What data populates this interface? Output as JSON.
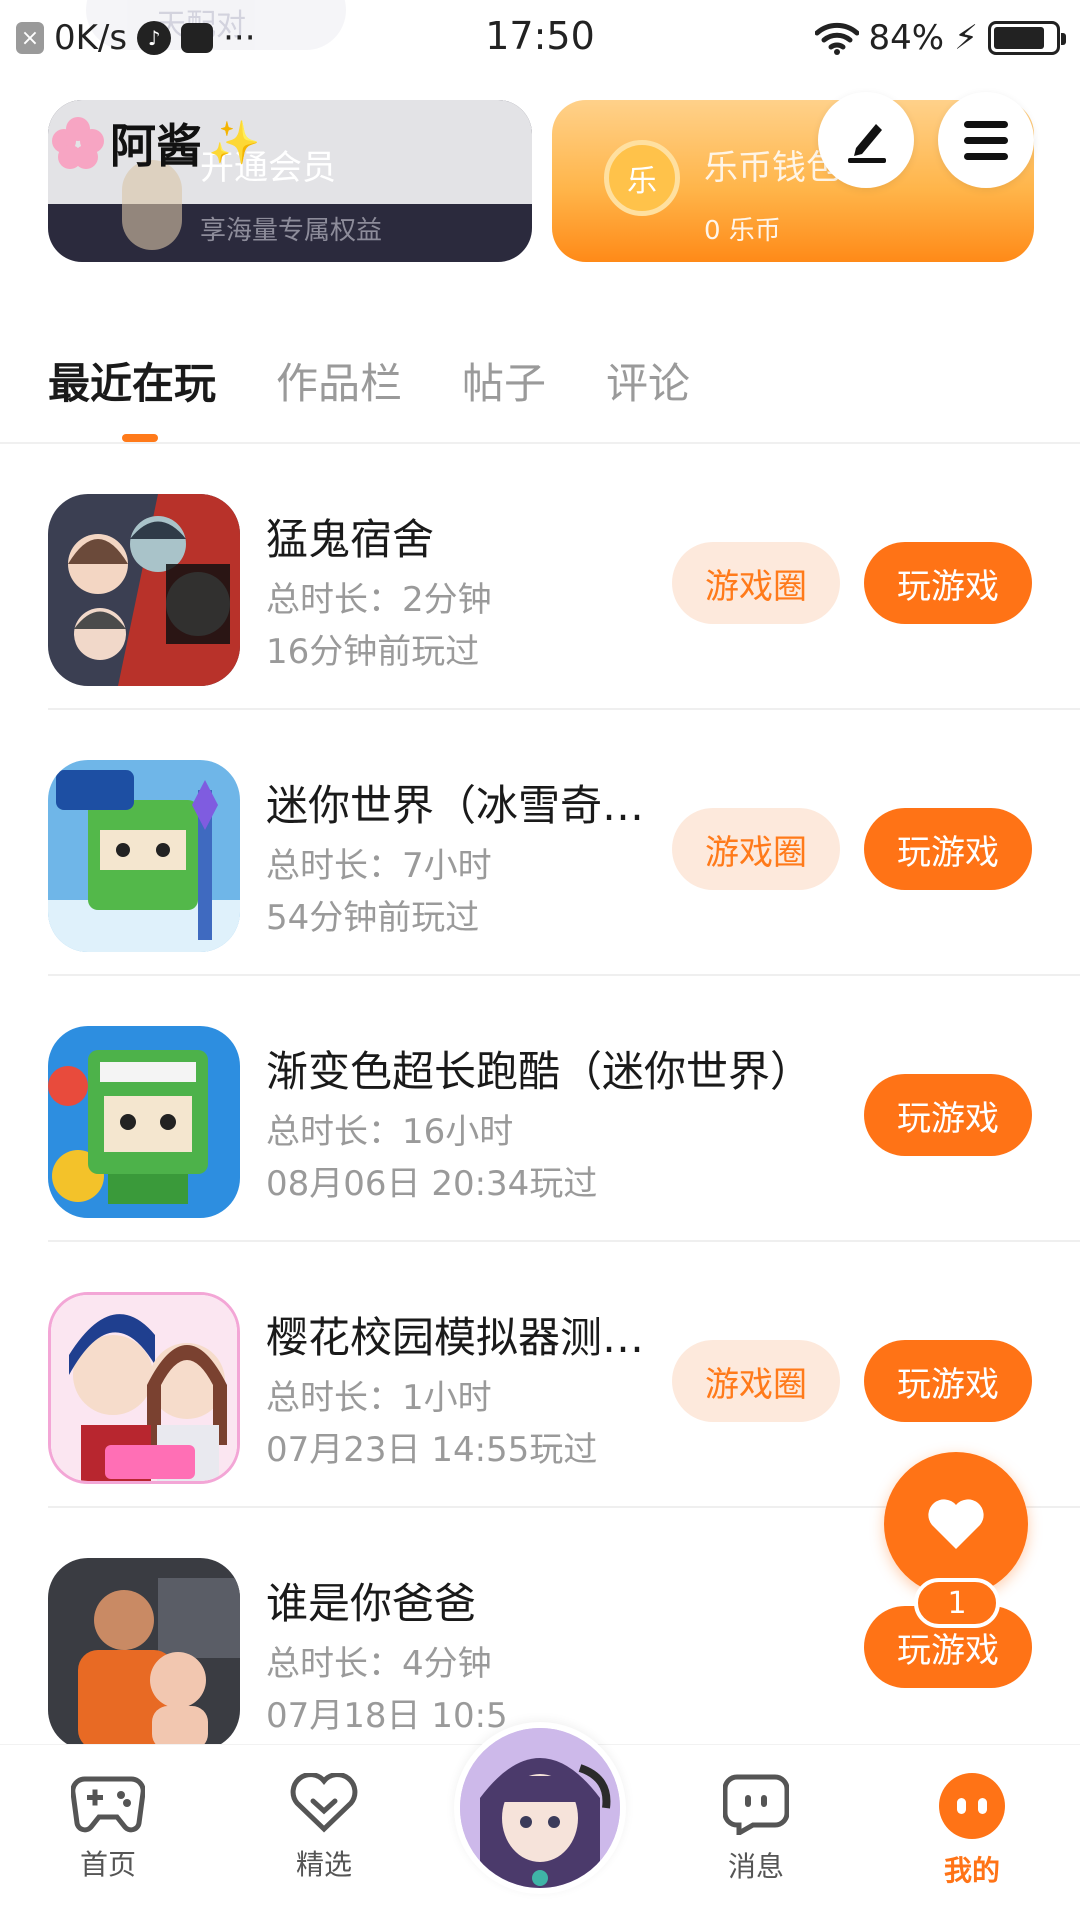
{
  "status_bar": {
    "net_speed": "0K/s",
    "time": "17:50",
    "battery": "84%",
    "battery_level": 0.84
  },
  "faded_banner": "天配对",
  "header": {
    "username": "阿酱",
    "vip_card": {
      "title": "开通会员",
      "subtitle": "享海量专属权益"
    },
    "wallet_card": {
      "title": "乐币钱包",
      "subtitle": "0 乐币",
      "coin_label": "乐"
    }
  },
  "tabs": [
    {
      "label": "最近在玩",
      "active": true
    },
    {
      "label": "作品栏",
      "active": false
    },
    {
      "label": "帖子",
      "active": false
    },
    {
      "label": "评论",
      "active": false
    }
  ],
  "buttons": {
    "circle": "游戏圈",
    "play": "玩游戏"
  },
  "games": [
    {
      "name": "猛鬼宿舍",
      "duration": "总时长：2分钟",
      "last_played": "16分钟前玩过",
      "has_circle": true
    },
    {
      "name": "迷你世界（冰雪奇…",
      "duration": "总时长：7小时",
      "last_played": "54分钟前玩过",
      "has_circle": true
    },
    {
      "name": "渐变色超长跑酷（迷你世界）",
      "duration": "总时长：16小时",
      "last_played": "08月06日 20:34玩过",
      "has_circle": false
    },
    {
      "name": "樱花校园模拟器测…",
      "duration": "总时长：1小时",
      "last_played": "07月23日 14:55玩过",
      "has_circle": true
    },
    {
      "name": "谁是你爸爸",
      "duration": "总时长：4分钟",
      "last_played": "07月18日 10:5",
      "has_circle": false
    }
  ],
  "float_heart": {
    "count": "1"
  },
  "bottom_nav": [
    {
      "label": "首页",
      "icon": "gamepad-icon"
    },
    {
      "label": "精选",
      "icon": "heart-outline-icon"
    },
    {
      "label": "消息",
      "icon": "chat-icon"
    },
    {
      "label": "我的",
      "icon": "profile-icon",
      "active": true
    }
  ],
  "colors": {
    "accent": "#ff7316",
    "accent_light": "#fde9dc",
    "text_primary": "#1a1a1a",
    "text_secondary": "#9a9a9a"
  }
}
